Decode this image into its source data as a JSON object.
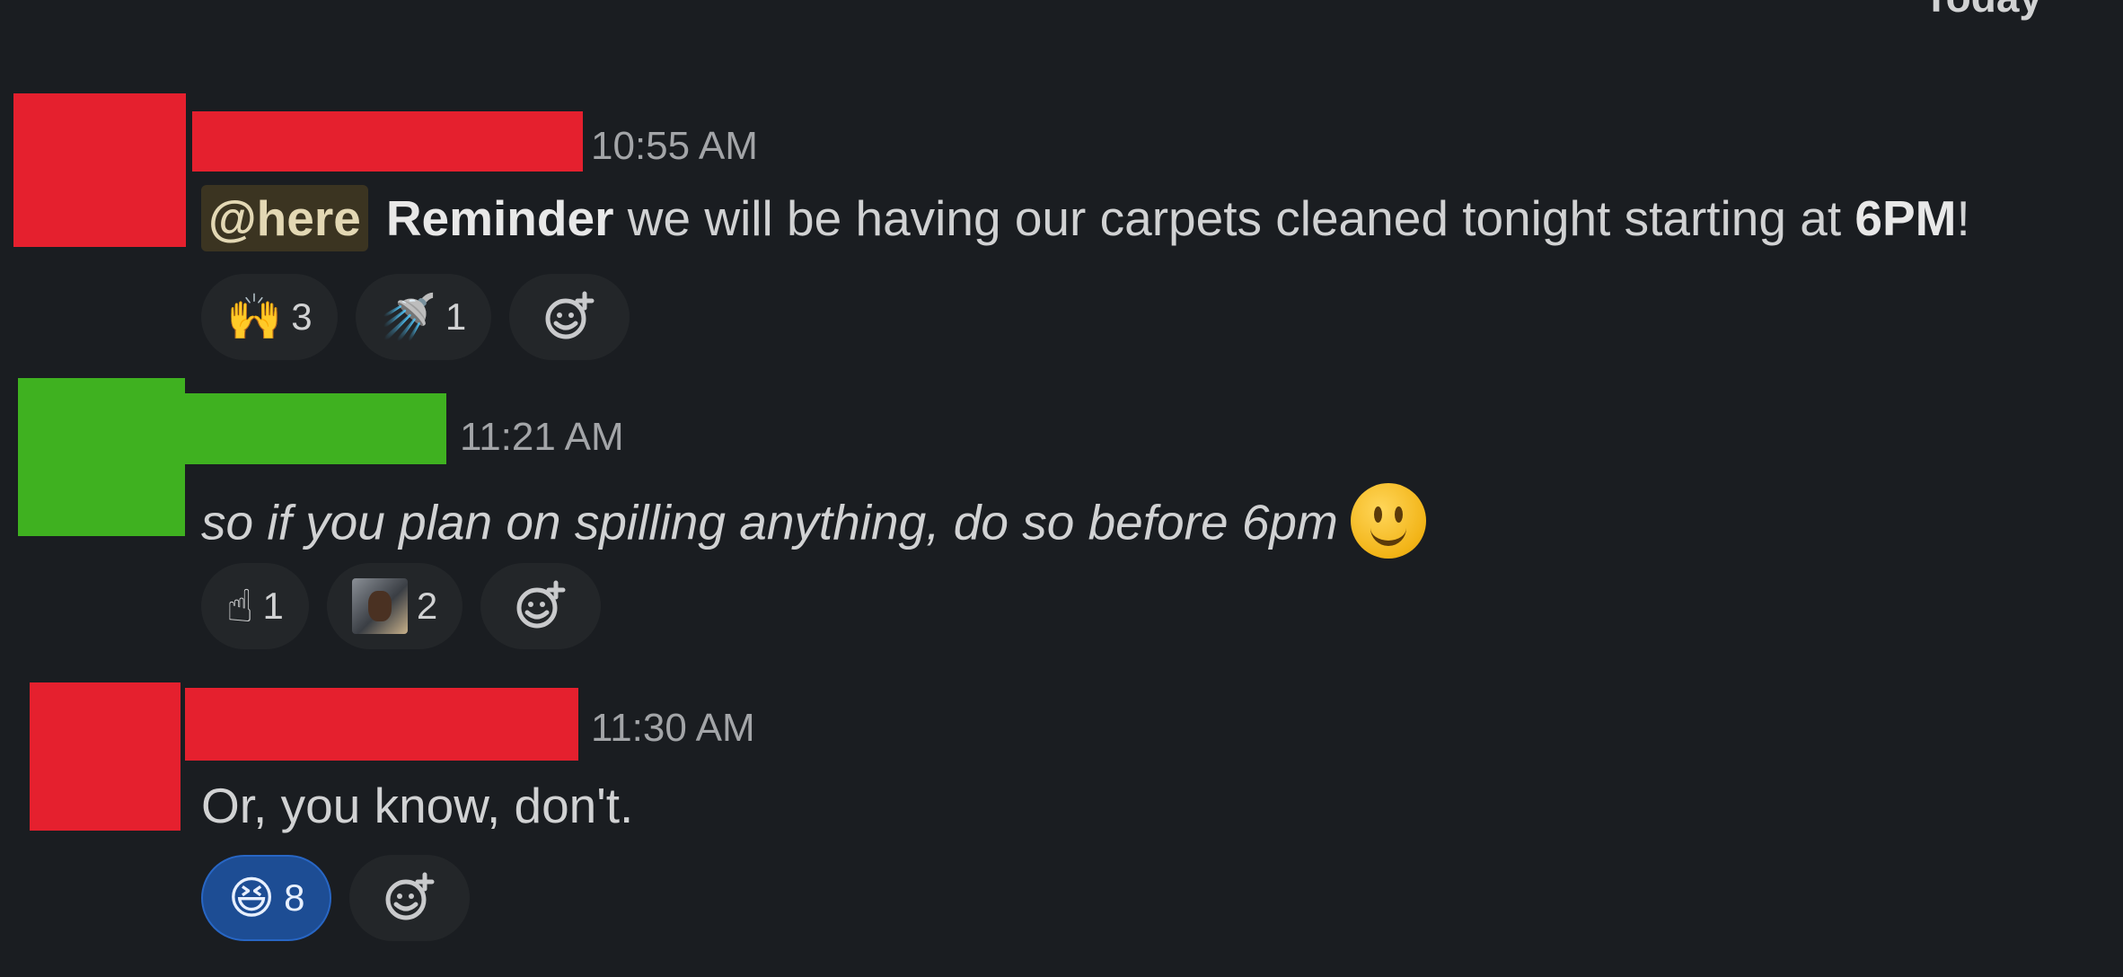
{
  "header": {
    "day": "Today"
  },
  "messages": [
    {
      "avatar_color": "#e5202e",
      "name_color": "#e5202e",
      "time": "10:55 AM",
      "mention": "@here",
      "bold_lead": "Reminder",
      "text": " we will be having our carpets cleaned tonight starting at ",
      "bold_end": "6PM",
      "tail": "!",
      "reactions": [
        {
          "emoji": "🙌",
          "count": "3"
        },
        {
          "emoji": "🚿",
          "count": "1"
        }
      ]
    },
    {
      "avatar_color": "#3fb120",
      "name_color": "#3fb120",
      "time": "11:21 AM",
      "text": "so if you plan on spilling anything, do so before 6pm",
      "reactions": [
        {
          "emoji": "☝",
          "count": "1"
        },
        {
          "emoji": "custom-photo",
          "count": "2"
        }
      ]
    },
    {
      "avatar_color": "#e5202e",
      "name_color": "#e5202e",
      "time": "11:30 AM",
      "text": "Or, you know, don't.",
      "reactions": [
        {
          "emoji": "😆",
          "count": "8",
          "active": true
        }
      ]
    }
  ]
}
